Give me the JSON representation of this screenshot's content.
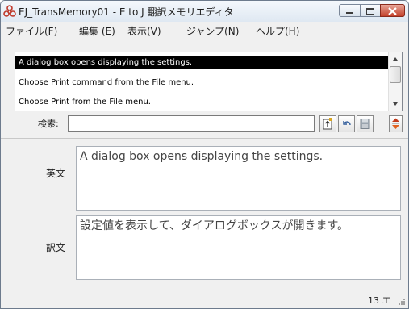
{
  "window": {
    "title": "EJ_TransMemory01 - E to J 翻訳メモリエディタ",
    "icon": "biohazard-app-icon"
  },
  "menu": {
    "items": [
      {
        "label": "ファイル(F)"
      },
      {
        "label": "編集 (E)"
      },
      {
        "label": "表示(V)"
      },
      {
        "label": "ジャンプ(N)"
      },
      {
        "label": "ヘルプ(H)"
      }
    ]
  },
  "entry_list": {
    "items": [
      {
        "text": "A dialog box opens displaying the settings.",
        "selected": true
      },
      {
        "text": "Choose Print command from the File menu.",
        "selected": false
      },
      {
        "text": "Choose Print from the File menu.",
        "selected": false
      }
    ]
  },
  "search": {
    "label": "検索:",
    "value": ""
  },
  "toolbar": {
    "buttons": [
      "insert-entry-icon",
      "undo-icon",
      "save-icon",
      "up-down-arrows-icon"
    ]
  },
  "editor": {
    "english_label": "英文",
    "english_text": "A dialog box opens displaying the settings.",
    "translation_label": "訳文",
    "translation_text": "設定値を表示して、ダイアログボックスが開きます。"
  },
  "status": {
    "count": "13 エ"
  },
  "colors": {
    "selection": "#000000",
    "close_button": "#c2402a"
  }
}
